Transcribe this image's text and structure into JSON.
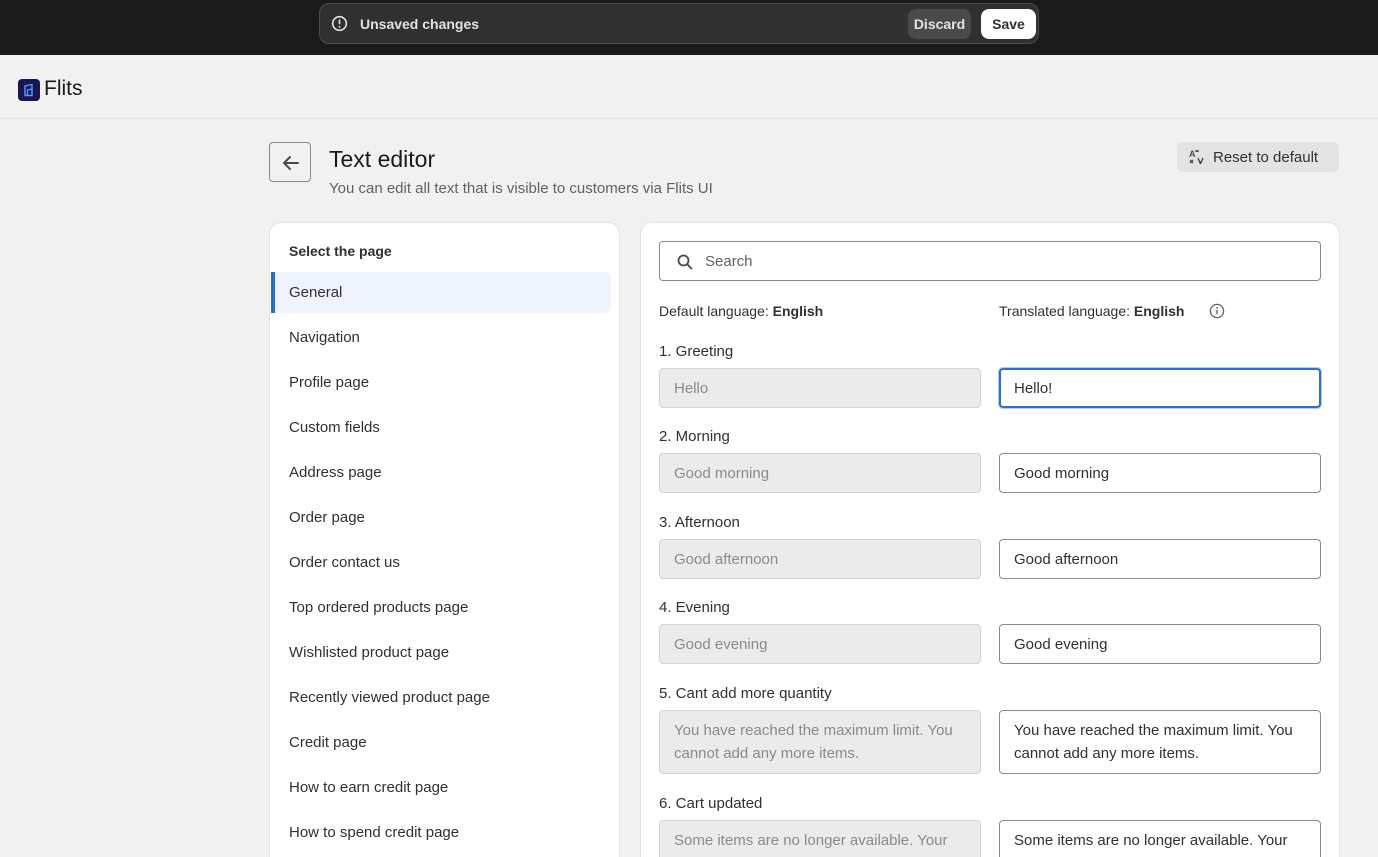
{
  "savebar": {
    "message": "Unsaved changes",
    "discard_label": "Discard",
    "save_label": "Save"
  },
  "app": {
    "name": "Flits"
  },
  "header": {
    "title": "Text editor",
    "subtitle": "You can edit all text that is visible to customers via Flits UI",
    "reset_label": "Reset to default"
  },
  "sidebar": {
    "heading": "Select the page",
    "items": [
      {
        "label": "General",
        "active": true
      },
      {
        "label": "Navigation"
      },
      {
        "label": "Profile page"
      },
      {
        "label": "Custom fields"
      },
      {
        "label": "Address page"
      },
      {
        "label": "Order page"
      },
      {
        "label": "Order contact us"
      },
      {
        "label": "Top ordered products page"
      },
      {
        "label": "Wishlisted product page"
      },
      {
        "label": "Recently viewed product page"
      },
      {
        "label": "Credit page"
      },
      {
        "label": "How to earn credit page"
      },
      {
        "label": "How to spend credit page"
      }
    ]
  },
  "editor": {
    "search_placeholder": "Search",
    "default_language_label": "Default language:",
    "default_language": "English",
    "translated_language_label": "Translated language:",
    "translated_language": "English",
    "fields": [
      {
        "label": "1. Greeting",
        "default": "Hello",
        "translated": "Hello!"
      },
      {
        "label": "2. Morning",
        "default": "Good morning",
        "translated": "Good morning"
      },
      {
        "label": "3. Afternoon",
        "default": "Good afternoon",
        "translated": "Good afternoon"
      },
      {
        "label": "4. Evening",
        "default": "Good evening",
        "translated": "Good evening"
      },
      {
        "label": "5. Cant add more quantity",
        "default": "You have reached the maximum limit. You cannot add any more items.",
        "translated": "You have reached the maximum limit. You cannot add any more items."
      },
      {
        "label": "6. Cart updated",
        "default": "Some items are no longer available. Your cart has been updated.",
        "translated": "Some items are no longer available. Your cart has been updated."
      }
    ]
  },
  "colors": {
    "topbar": "#1a1a1a",
    "brand": "#1b1651",
    "accent": "#2c6ecb",
    "active_nav_bg": "#eef3fd"
  }
}
